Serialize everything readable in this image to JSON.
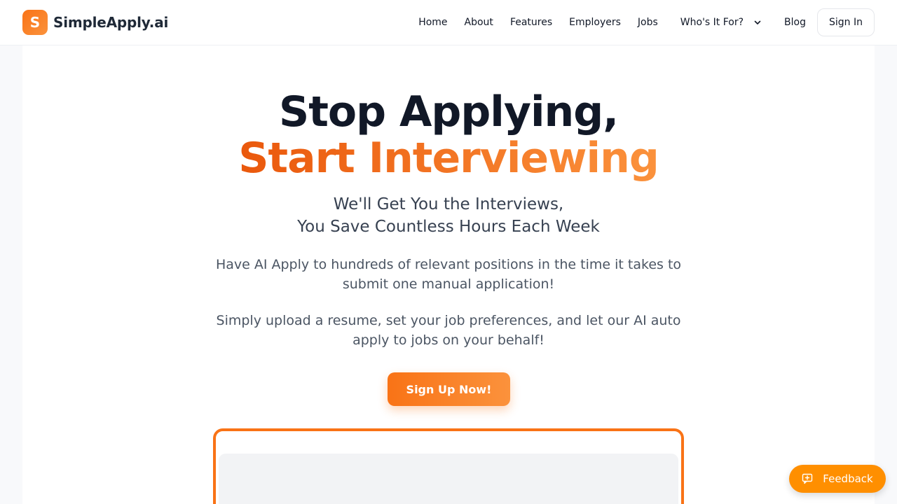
{
  "brand": {
    "logo_letter": "S",
    "name": "SimpleApply.ai"
  },
  "nav": {
    "items": [
      "Home",
      "About",
      "Features",
      "Employers",
      "Jobs"
    ],
    "dropdown_label": "Who's It For?",
    "blog": "Blog",
    "signin": "Sign In"
  },
  "hero": {
    "title_line1": "Stop Applying,",
    "title_line2": "Start Interviewing",
    "subtitle_line1": "We'll Get You the Interviews,",
    "subtitle_line2": "You Save Countless Hours Each Week",
    "paragraph1": "Have AI Apply to hundreds of relevant positions in the time it takes to submit one manual application!",
    "paragraph2": "Simply upload a resume, set your job preferences, and let our AI auto apply to jobs on your behalf!",
    "cta": "Sign Up Now!"
  },
  "feedback": {
    "label": "Feedback"
  },
  "colors": {
    "accent": "#f97316",
    "accent_light": "#fb923c",
    "feedback": "#ff8f00",
    "text_dark": "#111827"
  },
  "icons": {
    "dropdown": "chevron-down-icon",
    "feedback": "feedback-icon"
  }
}
